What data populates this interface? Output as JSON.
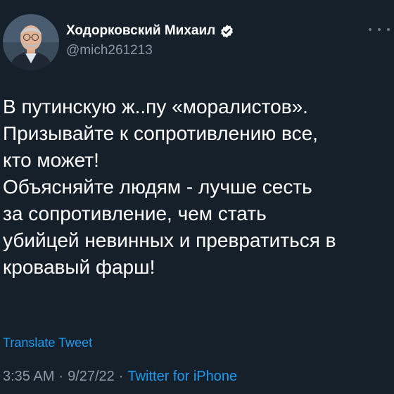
{
  "colors": {
    "background": "#15202b",
    "text": "#ffffff",
    "muted": "#8b98a5",
    "accent": "#1d9bf0"
  },
  "author": {
    "display_name": "Ходорковский Михаил",
    "handle": "@mich261213",
    "verified_icon": "verified-badge-icon",
    "avatar": "profile-photo"
  },
  "more_icon": "more-options-icon",
  "tweet": {
    "lines": [
      "В путинскую ж..пу «моралистов».",
      "Призывайте к сопротивлению все,",
      "кто может!",
      "Объясняйте людям - лучше сесть",
      "за сопротивление, чем стать",
      "убийцей невинных и превратиться в",
      "кровавый фарш!"
    ]
  },
  "translate_label": "Translate Tweet",
  "meta": {
    "time": "3:35 AM",
    "separator": "·",
    "date": "9/27/22",
    "source": "Twitter for iPhone"
  }
}
